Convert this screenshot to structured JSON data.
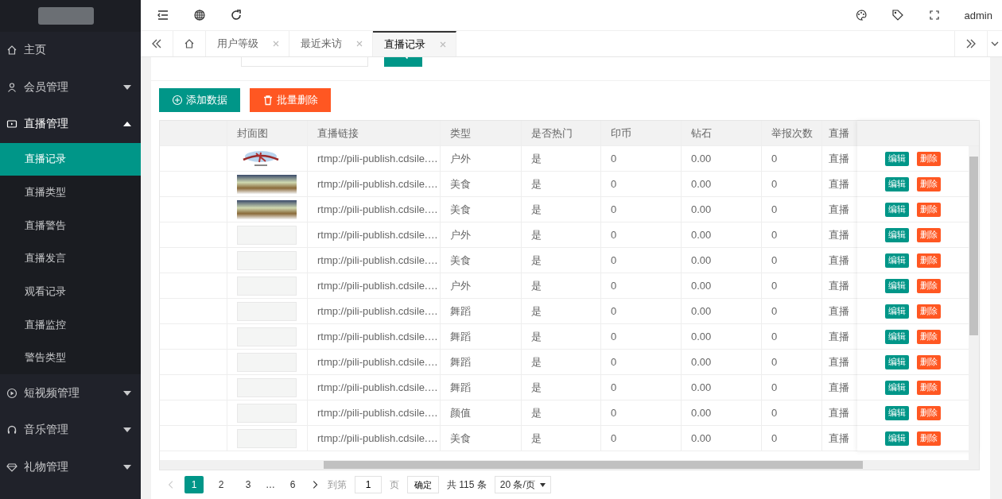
{
  "sidebar": {
    "items": [
      {
        "label": "主页"
      },
      {
        "label": "会员管理",
        "expanded": false
      },
      {
        "label": "直播管理",
        "expanded": true,
        "children": [
          {
            "label": "直播记录",
            "selected": true
          },
          {
            "label": "直播类型",
            "selected": false
          },
          {
            "label": "直播警告",
            "selected": false
          },
          {
            "label": "直播发言",
            "selected": false
          },
          {
            "label": "观看记录",
            "selected": false
          },
          {
            "label": "直播监控",
            "selected": false
          },
          {
            "label": "警告类型",
            "selected": false
          }
        ]
      },
      {
        "label": "短视频管理",
        "expanded": false
      },
      {
        "label": "音乐管理",
        "expanded": false
      },
      {
        "label": "礼物管理",
        "expanded": false
      }
    ]
  },
  "header": {
    "user": "admin"
  },
  "tabs": [
    {
      "label": "用户等级",
      "selected": false
    },
    {
      "label": "最近来访",
      "selected": false
    },
    {
      "label": "直播记录",
      "selected": true
    }
  ],
  "toolbar": {
    "add_button": "添加数据",
    "batch_delete_button": "批量删除"
  },
  "table": {
    "columns": [
      "封面图",
      "直播链接",
      "类型",
      "是否热门",
      "印币",
      "钻石",
      "举报次数",
      "直播"
    ],
    "rows": [
      {
        "cells": [
          {
            "kind": "emblem"
          },
          "rtmp://pili-publish.cdsile.…",
          "户外",
          "是",
          "0",
          "0.00",
          "0",
          "直播"
        ],
        "actions": [
          "编辑",
          "删除"
        ]
      },
      {
        "cells": [
          {
            "kind": "food"
          },
          "rtmp://pili-publish.cdsile.…",
          "美食",
          "是",
          "0",
          "0.00",
          "0",
          "直播"
        ],
        "actions": [
          "编辑",
          "删除"
        ]
      },
      {
        "cells": [
          {
            "kind": "food"
          },
          "rtmp://pili-publish.cdsile.…",
          "美食",
          "是",
          "0",
          "0.00",
          "0",
          "直播"
        ],
        "actions": [
          "编辑",
          "删除"
        ]
      },
      {
        "cells": [
          {
            "kind": "blank"
          },
          "rtmp://pili-publish.cdsile.…",
          "户外",
          "是",
          "0",
          "0.00",
          "0",
          "直播"
        ],
        "actions": [
          "编辑",
          "删除"
        ]
      },
      {
        "cells": [
          {
            "kind": "blank"
          },
          "rtmp://pili-publish.cdsile.…",
          "美食",
          "是",
          "0",
          "0.00",
          "0",
          "直播"
        ],
        "actions": [
          "编辑",
          "删除"
        ]
      },
      {
        "cells": [
          {
            "kind": "blank"
          },
          "rtmp://pili-publish.cdsile.…",
          "户外",
          "是",
          "0",
          "0.00",
          "0",
          "直播"
        ],
        "actions": [
          "编辑",
          "删除"
        ]
      },
      {
        "cells": [
          {
            "kind": "blank"
          },
          "rtmp://pili-publish.cdsile.…",
          "舞蹈",
          "是",
          "0",
          "0.00",
          "0",
          "直播"
        ],
        "actions": [
          "编辑",
          "删除"
        ]
      },
      {
        "cells": [
          {
            "kind": "blank"
          },
          "rtmp://pili-publish.cdsile.…",
          "舞蹈",
          "是",
          "0",
          "0.00",
          "0",
          "直播"
        ],
        "actions": [
          "编辑",
          "删除"
        ]
      },
      {
        "cells": [
          {
            "kind": "blank"
          },
          "rtmp://pili-publish.cdsile.…",
          "舞蹈",
          "是",
          "0",
          "0.00",
          "0",
          "直播"
        ],
        "actions": [
          "编辑",
          "删除"
        ]
      },
      {
        "cells": [
          {
            "kind": "blank"
          },
          "rtmp://pili-publish.cdsile.…",
          "舞蹈",
          "是",
          "0",
          "0.00",
          "0",
          "直播"
        ],
        "actions": [
          "编辑",
          "删除"
        ]
      },
      {
        "cells": [
          {
            "kind": "blank"
          },
          "rtmp://pili-publish.cdsile.…",
          "颜值",
          "是",
          "0",
          "0.00",
          "0",
          "直播"
        ],
        "actions": [
          "编辑",
          "删除"
        ]
      },
      {
        "cells": [
          {
            "kind": "blank"
          },
          "rtmp://pili-publish.cdsile.…",
          "美食",
          "是",
          "0",
          "0.00",
          "0",
          "直播"
        ],
        "actions": [
          "编辑",
          "删除"
        ]
      }
    ]
  },
  "pagination": {
    "pages": [
      {
        "label": "1",
        "selected": true
      },
      {
        "label": "2",
        "selected": false
      },
      {
        "label": "3",
        "selected": false
      },
      {
        "label": "…",
        "kind": "ellipsis"
      },
      {
        "label": "6",
        "selected": false
      }
    ],
    "goto_label": "到第",
    "goto_value": "1",
    "page_unit": "页",
    "confirm_button": "确定",
    "total": "共 115 条",
    "page_size": "20 条/页"
  }
}
